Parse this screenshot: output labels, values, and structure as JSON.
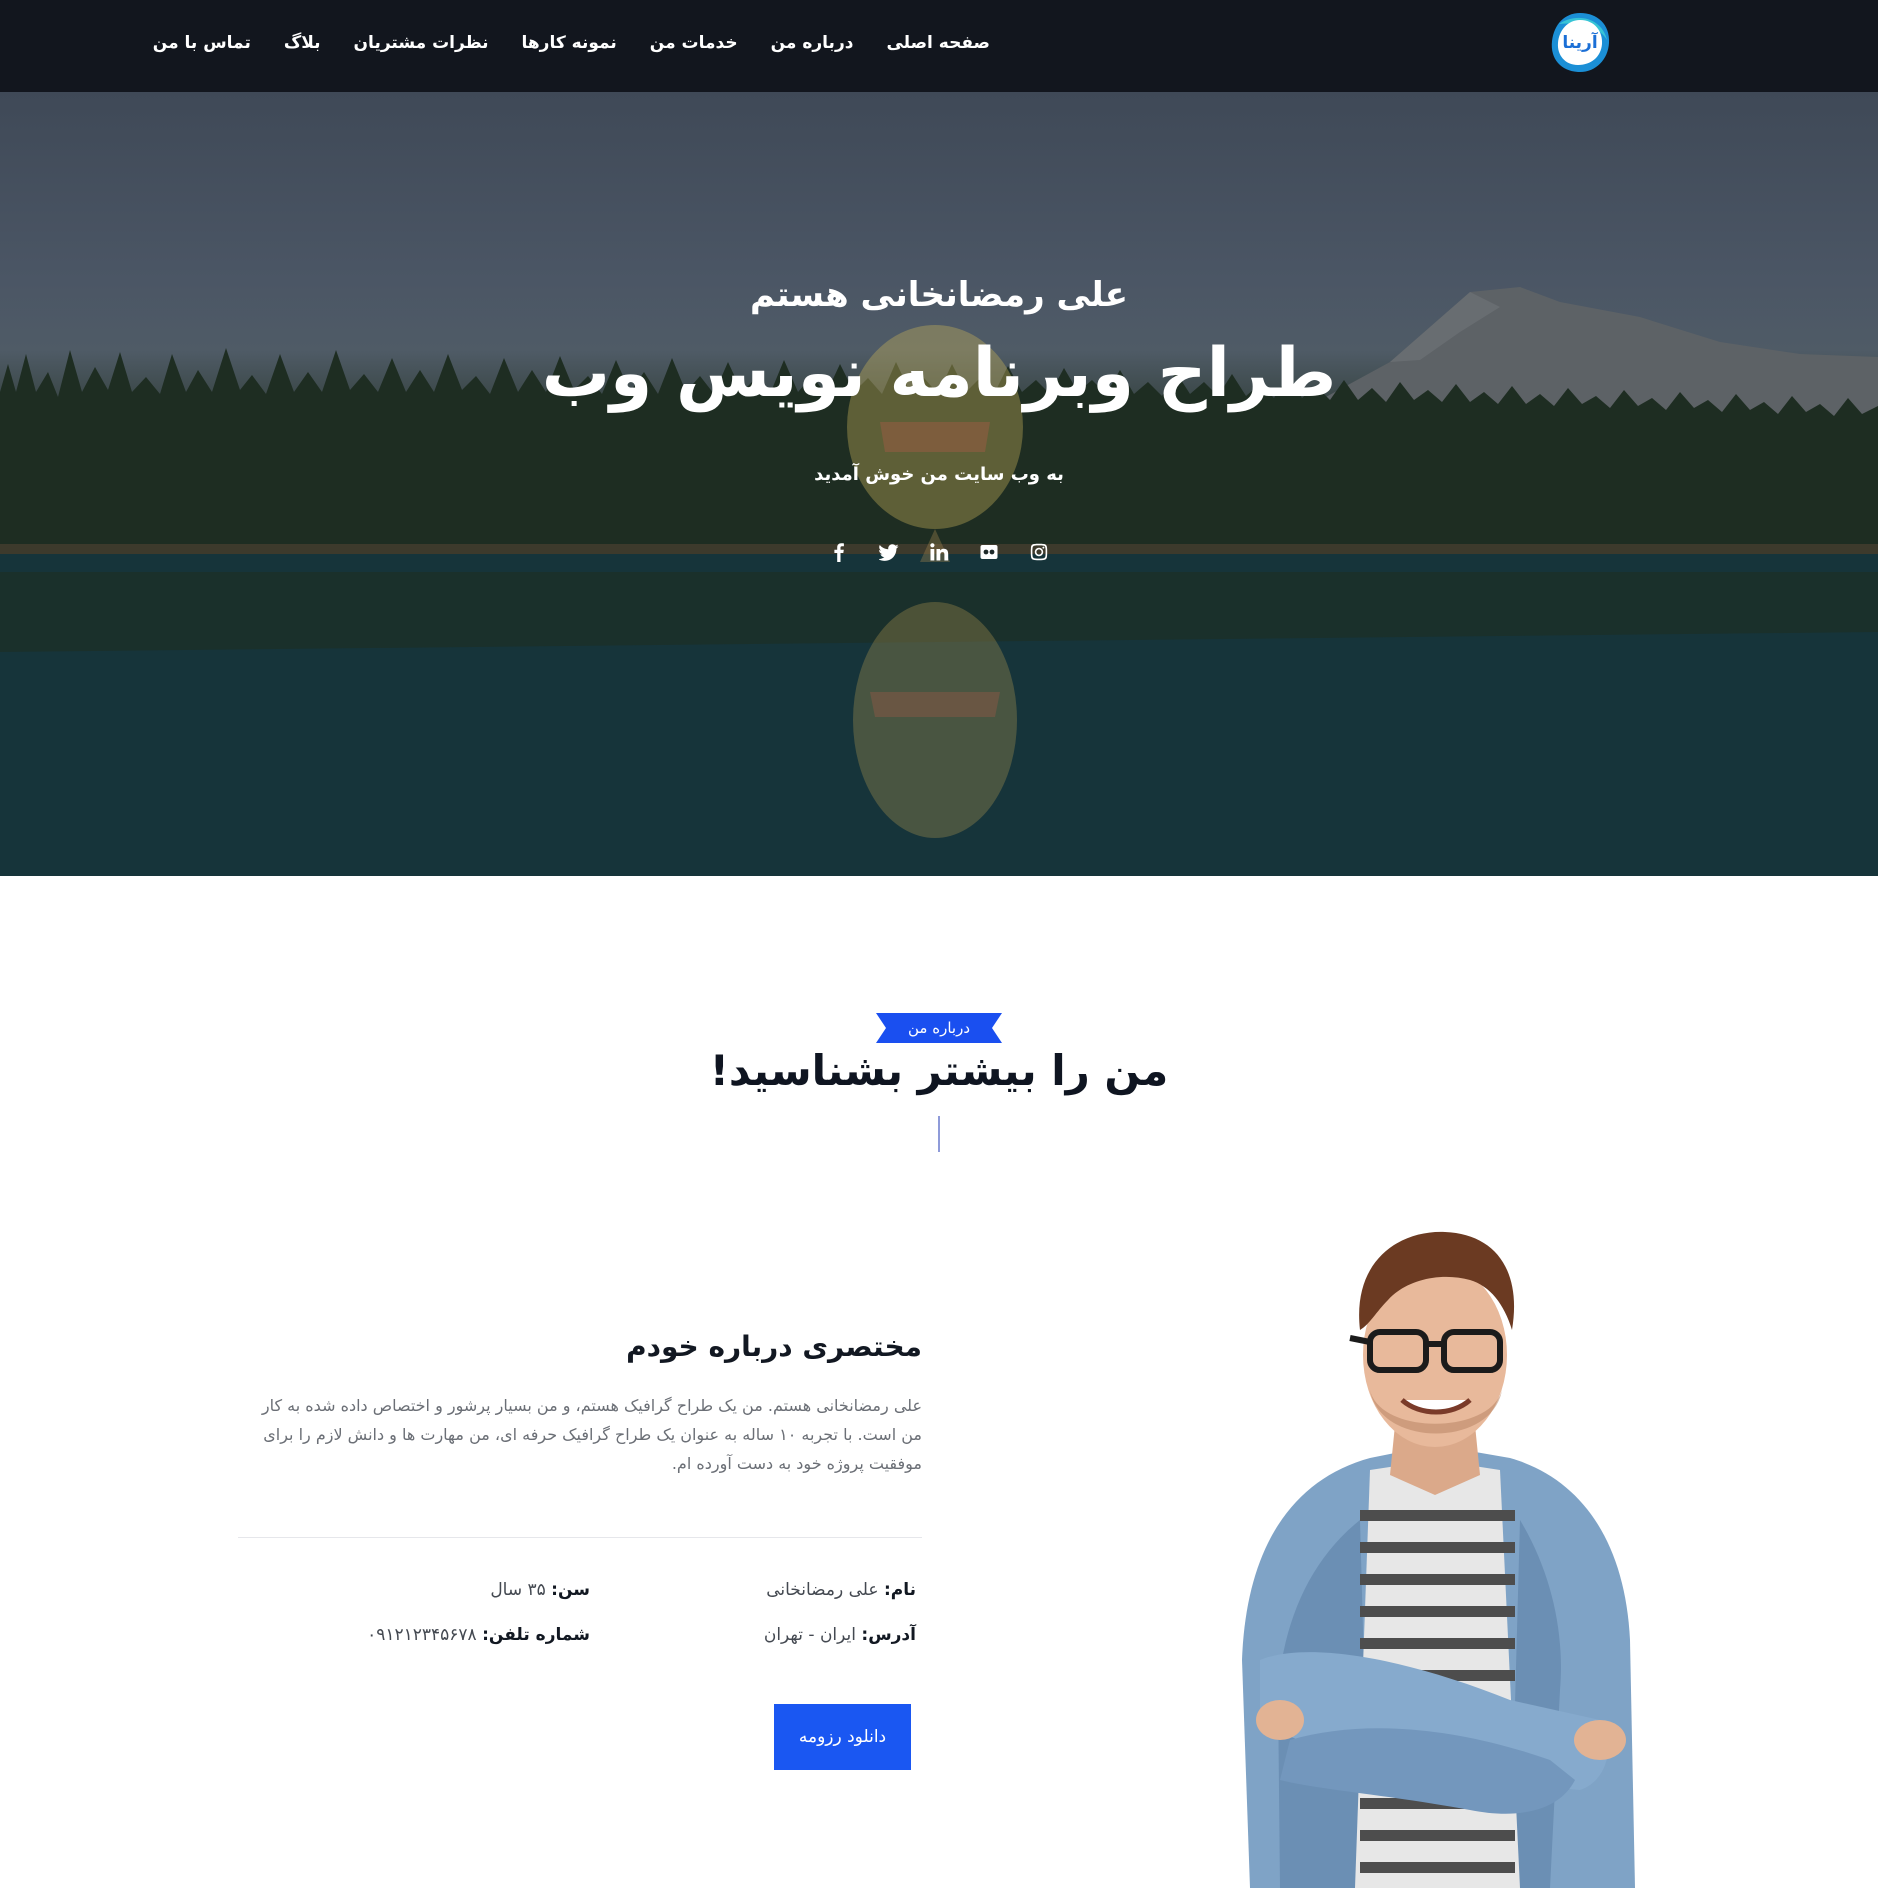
{
  "brand": {
    "logo_text": "آرینا",
    "logo_colors": [
      "#1b8fd6",
      "#37c4d6",
      "#ffffff"
    ]
  },
  "nav": {
    "items": [
      {
        "label": "صفحه اصلی"
      },
      {
        "label": "درباره من"
      },
      {
        "label": "خدمات من"
      },
      {
        "label": "نمونه کارها"
      },
      {
        "label": "نظرات مشتریان"
      },
      {
        "label": "بلاگ"
      },
      {
        "label": "تماس با من"
      }
    ]
  },
  "hero": {
    "kicker": "علی رمضانخانی هستم",
    "title": "طراح وبرنامه نویس وب",
    "subtitle": "به وب سایت من خوش آمدید",
    "socials": [
      "facebook-icon",
      "twitter-icon",
      "linkedin-icon",
      "flickr-icon",
      "instagram-icon"
    ]
  },
  "about": {
    "tag": "درباره من",
    "heading": "من را بیشتر بشناسید!",
    "subtitle": "مختصری درباره خودم",
    "paragraph": "علی رمضانخانی هستم. من یک طراح گرافیک هستم، و من بسیار پرشور و اختصاص داده شده به کار من است. با تجربه ۱۰ ساله به عنوان یک طراح گرافیک حرفه ای، من مهارت ها و دانش لازم را برای موفقیت پروژه خود به دست آورده ام.",
    "info": {
      "name_label": "نام:",
      "name_value": "علی رمضانخانی",
      "age_label": "سن:",
      "age_value": "۳۵ سال",
      "address_label": "آدرس:",
      "address_value": "ایران - تهران",
      "phone_label": "شماره تلفن:",
      "phone_value": "۰۹۱۲۱۲۳۴۵۶۷۸"
    },
    "resume_button": "دانلود رزومه"
  },
  "colors": {
    "navbar": "#12161e",
    "accent": "#1a57f2",
    "tag": "#1a4ff0"
  }
}
